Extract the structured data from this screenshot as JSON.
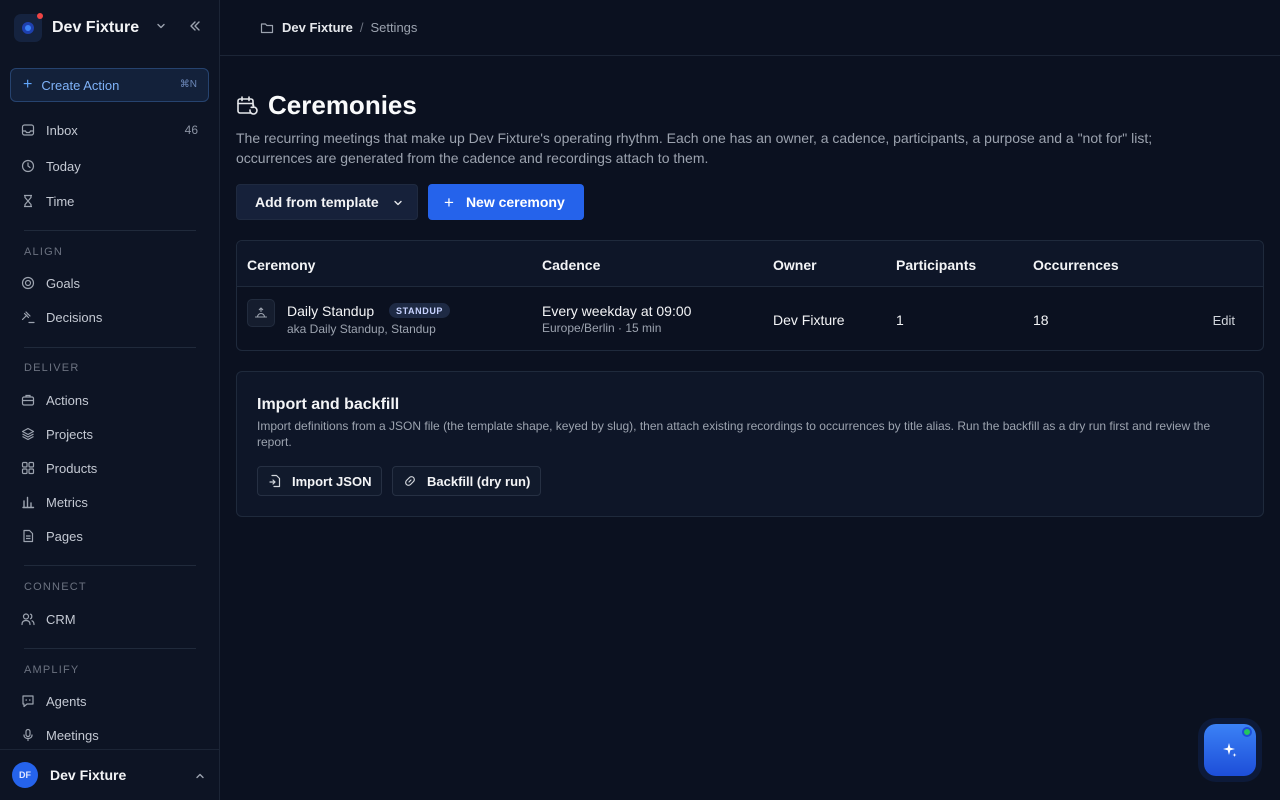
{
  "workspace": {
    "name": "Dev Fixture"
  },
  "sidebar": {
    "create": {
      "label": "Create Action",
      "shortcut": "⌘N"
    },
    "top_items": [
      {
        "label": "Inbox",
        "count": "46",
        "icon": "inbox-icon"
      },
      {
        "label": "Today",
        "icon": "clock-icon"
      },
      {
        "label": "Time",
        "icon": "hourglass-icon"
      }
    ],
    "sections": [
      {
        "label": "ALIGN",
        "items": [
          {
            "label": "Goals",
            "icon": "target-icon"
          },
          {
            "label": "Decisions",
            "icon": "gavel-icon"
          }
        ]
      },
      {
        "label": "DELIVER",
        "items": [
          {
            "label": "Actions",
            "icon": "briefcase-icon"
          },
          {
            "label": "Projects",
            "icon": "layers-icon"
          },
          {
            "label": "Products",
            "icon": "grid-icon"
          },
          {
            "label": "Metrics",
            "icon": "bar-chart-icon"
          },
          {
            "label": "Pages",
            "icon": "document-icon"
          }
        ]
      },
      {
        "label": "CONNECT",
        "items": [
          {
            "label": "CRM",
            "icon": "users-icon"
          }
        ]
      },
      {
        "label": "AMPLIFY",
        "items": [
          {
            "label": "Agents",
            "icon": "chat-bot-icon"
          },
          {
            "label": "Meetings",
            "icon": "microphone-icon"
          }
        ]
      }
    ],
    "user": {
      "initials": "DF",
      "name": "Dev Fixture"
    }
  },
  "breadcrumb": {
    "root": "Dev Fixture",
    "separator": "/",
    "current": "Settings"
  },
  "page": {
    "title": "Ceremonies",
    "description": "The recurring meetings that make up Dev Fixture's operating rhythm. Each one has an owner, a cadence, participants, a purpose and a \"not for\" list; occurrences are generated from the cadence and recordings attach to them.",
    "add_template_label": "Add from template",
    "new_label": "New ceremony"
  },
  "table": {
    "columns": [
      "Ceremony",
      "Cadence",
      "Owner",
      "Participants",
      "Occurrences"
    ],
    "rows": [
      {
        "name": "Daily Standup",
        "badge": "STANDUP",
        "aka": "aka Daily Standup, Standup",
        "cadence": "Every weekday at 09:00",
        "timezone": "Europe/Berlin · 15 min",
        "owner": "Dev Fixture",
        "participants": "1",
        "occurrences": "18",
        "action": "Edit"
      }
    ]
  },
  "import": {
    "title": "Import and backfill",
    "description": "Import definitions from a JSON file (the template shape, keyed by slug), then attach existing recordings to occurrences by title alias. Run the backfill as a dry run first and review the report.",
    "import_label": "Import JSON",
    "backfill_label": "Backfill (dry run)"
  },
  "colors": {
    "accent": "#2563eb",
    "background": "#0b1120",
    "sidebar": "#0d1424",
    "status_online": "#22c55e"
  }
}
